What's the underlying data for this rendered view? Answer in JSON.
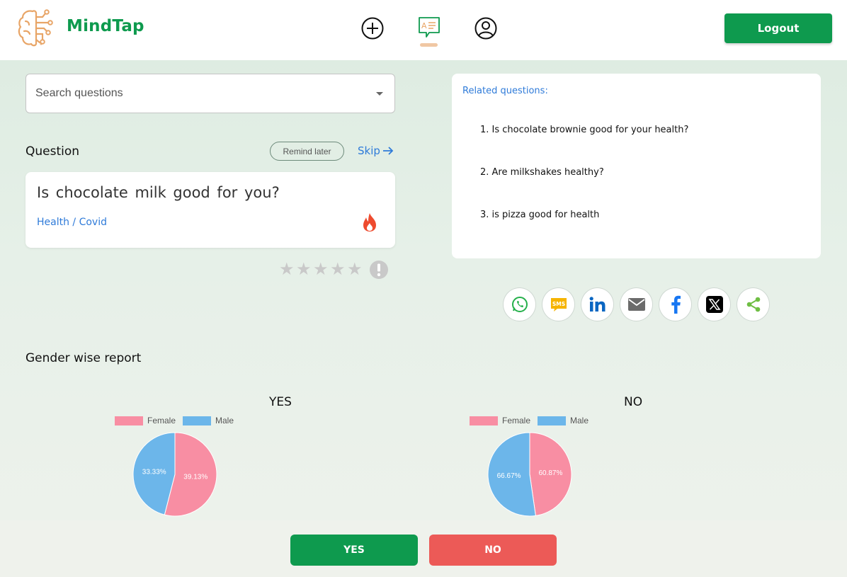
{
  "header": {
    "brand": "MindTap",
    "logout_label": "Logout",
    "nav_icons": [
      "plus-circle-icon",
      "chat-question-icon",
      "user-circle-icon"
    ]
  },
  "search": {
    "placeholder": "Search questions"
  },
  "question_section": {
    "title": "Question",
    "remind_label": "Remind later",
    "skip_label": "Skip",
    "question_text": "Is chocolate milk good for you?",
    "category": "Health / Covid",
    "rating_stars": 5,
    "rating_value": 0
  },
  "related": {
    "title": "Related questions:",
    "items": [
      "1. Is chocolate brownie good for your health?",
      "2. Are milkshakes healthy?",
      "3. is pizza good for health"
    ]
  },
  "share": {
    "icons": [
      "whatsapp-icon",
      "sms-icon",
      "linkedin-icon",
      "email-icon",
      "facebook-icon",
      "x-icon",
      "share-icon"
    ]
  },
  "report": {
    "title": "Gender wise report"
  },
  "chart_data": [
    {
      "type": "pie",
      "title": "YES",
      "legend": [
        "Female",
        "Male"
      ],
      "slices": [
        {
          "label": "Female",
          "value": 39.13,
          "label_text": "39.13%",
          "color": "#f88ea3"
        },
        {
          "label": "Male",
          "value": 33.33,
          "label_text": "33.33%",
          "color": "#6cb6ea"
        }
      ]
    },
    {
      "type": "pie",
      "title": "NO",
      "legend": [
        "Female",
        "Male"
      ],
      "slices": [
        {
          "label": "Female",
          "value": 60.87,
          "label_text": "60.87%",
          "color": "#f88ea3"
        },
        {
          "label": "Male",
          "value": 66.67,
          "label_text": "66.67%",
          "color": "#6cb6ea"
        }
      ]
    }
  ],
  "actions": {
    "yes_label": "YES",
    "no_label": "NO"
  },
  "colors": {
    "brand_green": "#0e9a4e",
    "no_red": "#ec5a57",
    "link_blue": "#2f7bd9",
    "female": "#f88ea3",
    "male": "#6cb6ea"
  }
}
